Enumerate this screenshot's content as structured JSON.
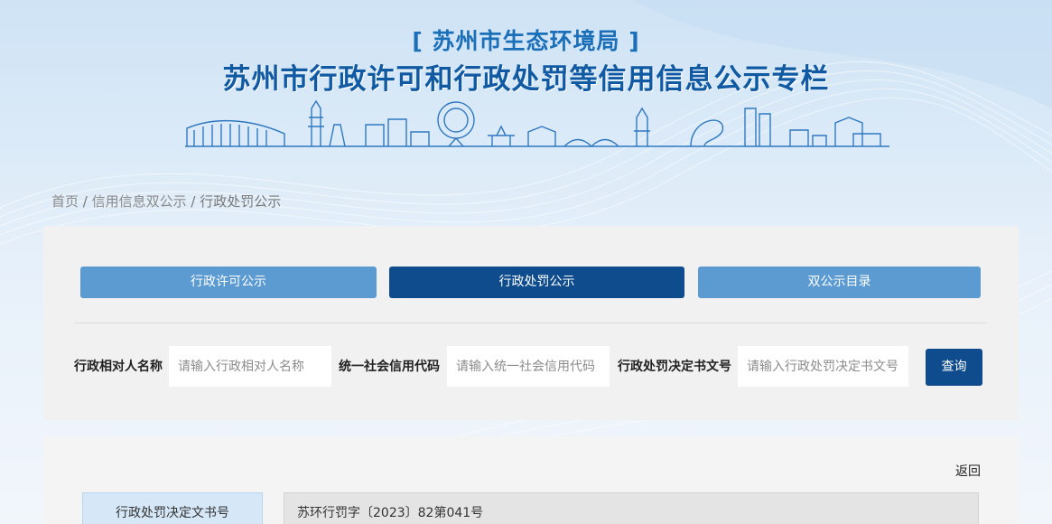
{
  "header": {
    "agency": "[ 苏州市生态环境局 ]",
    "title": "苏州市行政许可和行政处罚等信用信息公示专栏"
  },
  "breadcrumb": {
    "home": "首页",
    "sep1": " / ",
    "level2": "信用信息双公示",
    "sep2": " / ",
    "current": "行政处罚公示"
  },
  "tabs": [
    {
      "label": "行政许可公示",
      "active": false
    },
    {
      "label": "行政处罚公示",
      "active": true
    },
    {
      "label": "双公示目录",
      "active": false
    }
  ],
  "search": {
    "field1_label": "行政相对人名称",
    "field1_placeholder": "请输入行政相对人名称",
    "field2_label": "统一社会信用代码",
    "field2_placeholder": "请输入统一社会信用代码",
    "field3_label": "行政处罚决定书文号",
    "field3_placeholder": "请输入行政处罚决定书文号",
    "button": "查询"
  },
  "detail": {
    "back": "返回",
    "rows": [
      {
        "label": "行政处罚决定文书号",
        "value": "苏环行罚字〔2023〕82第041号"
      }
    ]
  },
  "colors": {
    "primary_dark": "#0e4c8d",
    "primary_light": "#5b9bd2",
    "title_blue": "#0f5aa3"
  }
}
